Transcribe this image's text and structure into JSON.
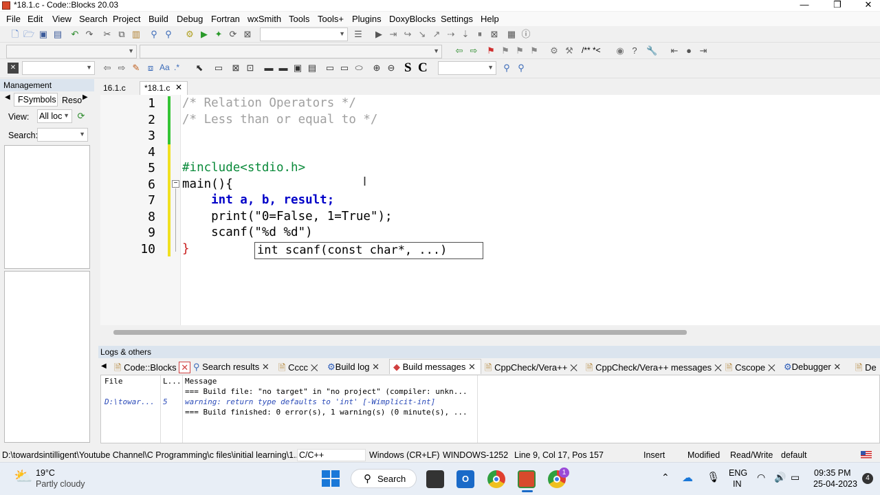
{
  "window": {
    "title": "*18.1.c - Code::Blocks 20.03"
  },
  "menu": [
    "File",
    "Edit",
    "View",
    "Search",
    "Project",
    "Build",
    "Debug",
    "Fortran",
    "wxSmith",
    "Tools",
    "Tools+",
    "Plugins",
    "DoxyBlocks",
    "Settings",
    "Help"
  ],
  "toolbar": {
    "doc_comment": "/** *<",
    "bold_s": "S",
    "bold_c": "C"
  },
  "management": {
    "title": "Management",
    "tab_fsymbols": "FSymbols",
    "tab_resources": "Reso",
    "view_label": "View:",
    "view_value": "All loc",
    "search_label": "Search:"
  },
  "editor": {
    "tabs": [
      {
        "label": "16.1.c"
      },
      {
        "label": "*18.1.c"
      }
    ],
    "line_numbers": [
      "1",
      "2",
      "3",
      "4",
      "5",
      "6",
      "7",
      "8",
      "9",
      "10"
    ],
    "lines": [
      "/* Relation Operators */",
      "/* Less than or equal to */",
      "",
      "",
      "#include<stdio.h>",
      "main(){",
      "    int a, b, result;",
      "    print(\"0=False, 1=True\");",
      "    scanf(\"%d %d\")",
      "}"
    ],
    "calltip": "int scanf(const char*, ...)"
  },
  "logs": {
    "title": "Logs & others",
    "tabs": [
      "Code::Blocks",
      "Search results",
      "Cccc",
      "Build log",
      "Build messages",
      "CppCheck/Vera++",
      "CppCheck/Vera++ messages",
      "Cscope",
      "Debugger",
      "De"
    ],
    "columns": [
      "File",
      "L...",
      "Message"
    ],
    "rows": [
      {
        "file": "",
        "line": "",
        "message": "=== Build file: \"no target\" in \"no project\" (compiler: unkn..."
      },
      {
        "file": "D:\\towar...",
        "line": "5",
        "message": "warning: return type defaults to 'int' [-Wimplicit-int]"
      },
      {
        "file": "",
        "line": "",
        "message": "=== Build finished: 0 error(s), 1 warning(s) (0 minute(s), ..."
      }
    ]
  },
  "status": {
    "path": "D:\\towardsintilligent\\Youtube Channel\\C Programming\\c files\\initial learning\\1...",
    "lang": "C/C++",
    "eol": "Windows (CR+LF)",
    "encoding": "WINDOWS-1252",
    "position": "Line 9, Col 17, Pos 157",
    "mode": "Insert",
    "modified": "Modified",
    "rw": "Read/Write",
    "profile": "default"
  },
  "taskbar": {
    "weather_temp": "19°C",
    "weather_desc": "Partly cloudy",
    "search": "Search",
    "lang_top": "ENG",
    "lang_bottom": "IN",
    "time": "09:35 PM",
    "date": "25-04-2023",
    "notif_count": "4",
    "chrome_badge": "1"
  },
  "colors": {
    "comment": "#a0a0a0",
    "preprocessor": "#0a8a3a",
    "keyword": "#0000c8",
    "string": "#1a3cc8"
  }
}
